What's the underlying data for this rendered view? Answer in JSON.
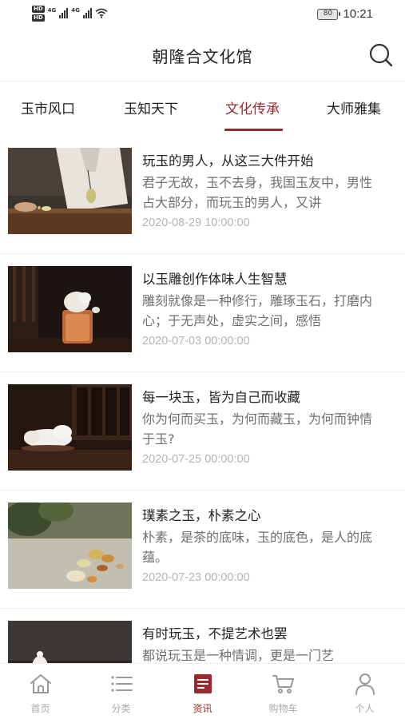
{
  "status_bar": {
    "hd_badge_1": "HD",
    "hd_badge_2": "HD",
    "net_1": "4G",
    "net_2": "4G",
    "battery": "80",
    "time": "10:21"
  },
  "header": {
    "title": "朝隆合文化馆",
    "search_icon": "search-icon"
  },
  "tabs": [
    {
      "label": "玉市风口",
      "active": false
    },
    {
      "label": "玉知天下",
      "active": false
    },
    {
      "label": "文化传承",
      "active": true
    },
    {
      "label": "大师雅集",
      "active": false
    }
  ],
  "accent_color": "#9b2a2e",
  "articles": [
    {
      "title": "玩玉的男人，从这三大件开始",
      "excerpt": "君子无故，玉不去身，我国玉友中，男性占大部分，而玩玉的男人，又讲",
      "date": "2020-08-29 10:00:00"
    },
    {
      "title": "以玉雕创作体味人生智慧",
      "excerpt": "雕刻就像是一种修行，雕琢玉石，打磨内心；于无声处，虚实之间，感悟",
      "date": "2020-07-03 00:00:00"
    },
    {
      "title": "每一块玉，皆为自己而收藏",
      "excerpt": "你为何而买玉，为何而藏玉，为何而钟情于玉?",
      "date": "2020-07-25 00:00:00"
    },
    {
      "title": "璞素之玉，朴素之心",
      "excerpt": "朴素，是茶的底味，玉的底色，是人的底蕴。",
      "date": "2020-07-23 00:00:00"
    },
    {
      "title": "有时玩玉，不提艺术也罢",
      "excerpt": "都说玩玉是一种情调，更是一门艺",
      "date": ""
    }
  ],
  "bottom_nav": [
    {
      "label": "首页",
      "icon": "home-icon",
      "active": false
    },
    {
      "label": "分类",
      "icon": "list-icon",
      "active": false
    },
    {
      "label": "资讯",
      "icon": "news-icon",
      "active": true
    },
    {
      "label": "购物车",
      "icon": "cart-icon",
      "active": false
    },
    {
      "label": "个人",
      "icon": "person-icon",
      "active": false
    }
  ]
}
